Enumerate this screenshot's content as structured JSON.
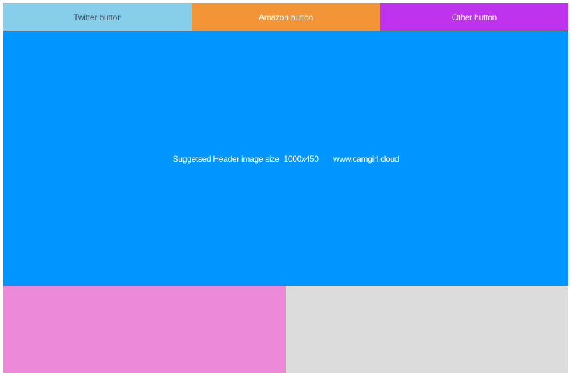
{
  "nav": {
    "twitter_label": "Twitter button",
    "amazon_label": "Amazon  button",
    "other_label": "Other  button"
  },
  "hero": {
    "text": "Suggetsed Header image size  1000x450       www.camgirl.cloud"
  },
  "colors": {
    "twitter": "#87ceeb",
    "amazon": "#f39436",
    "other": "#c033ee",
    "hero": "#0095ff",
    "bottom_left": "#ec8ad9",
    "bottom_right": "#dcdcdc"
  }
}
